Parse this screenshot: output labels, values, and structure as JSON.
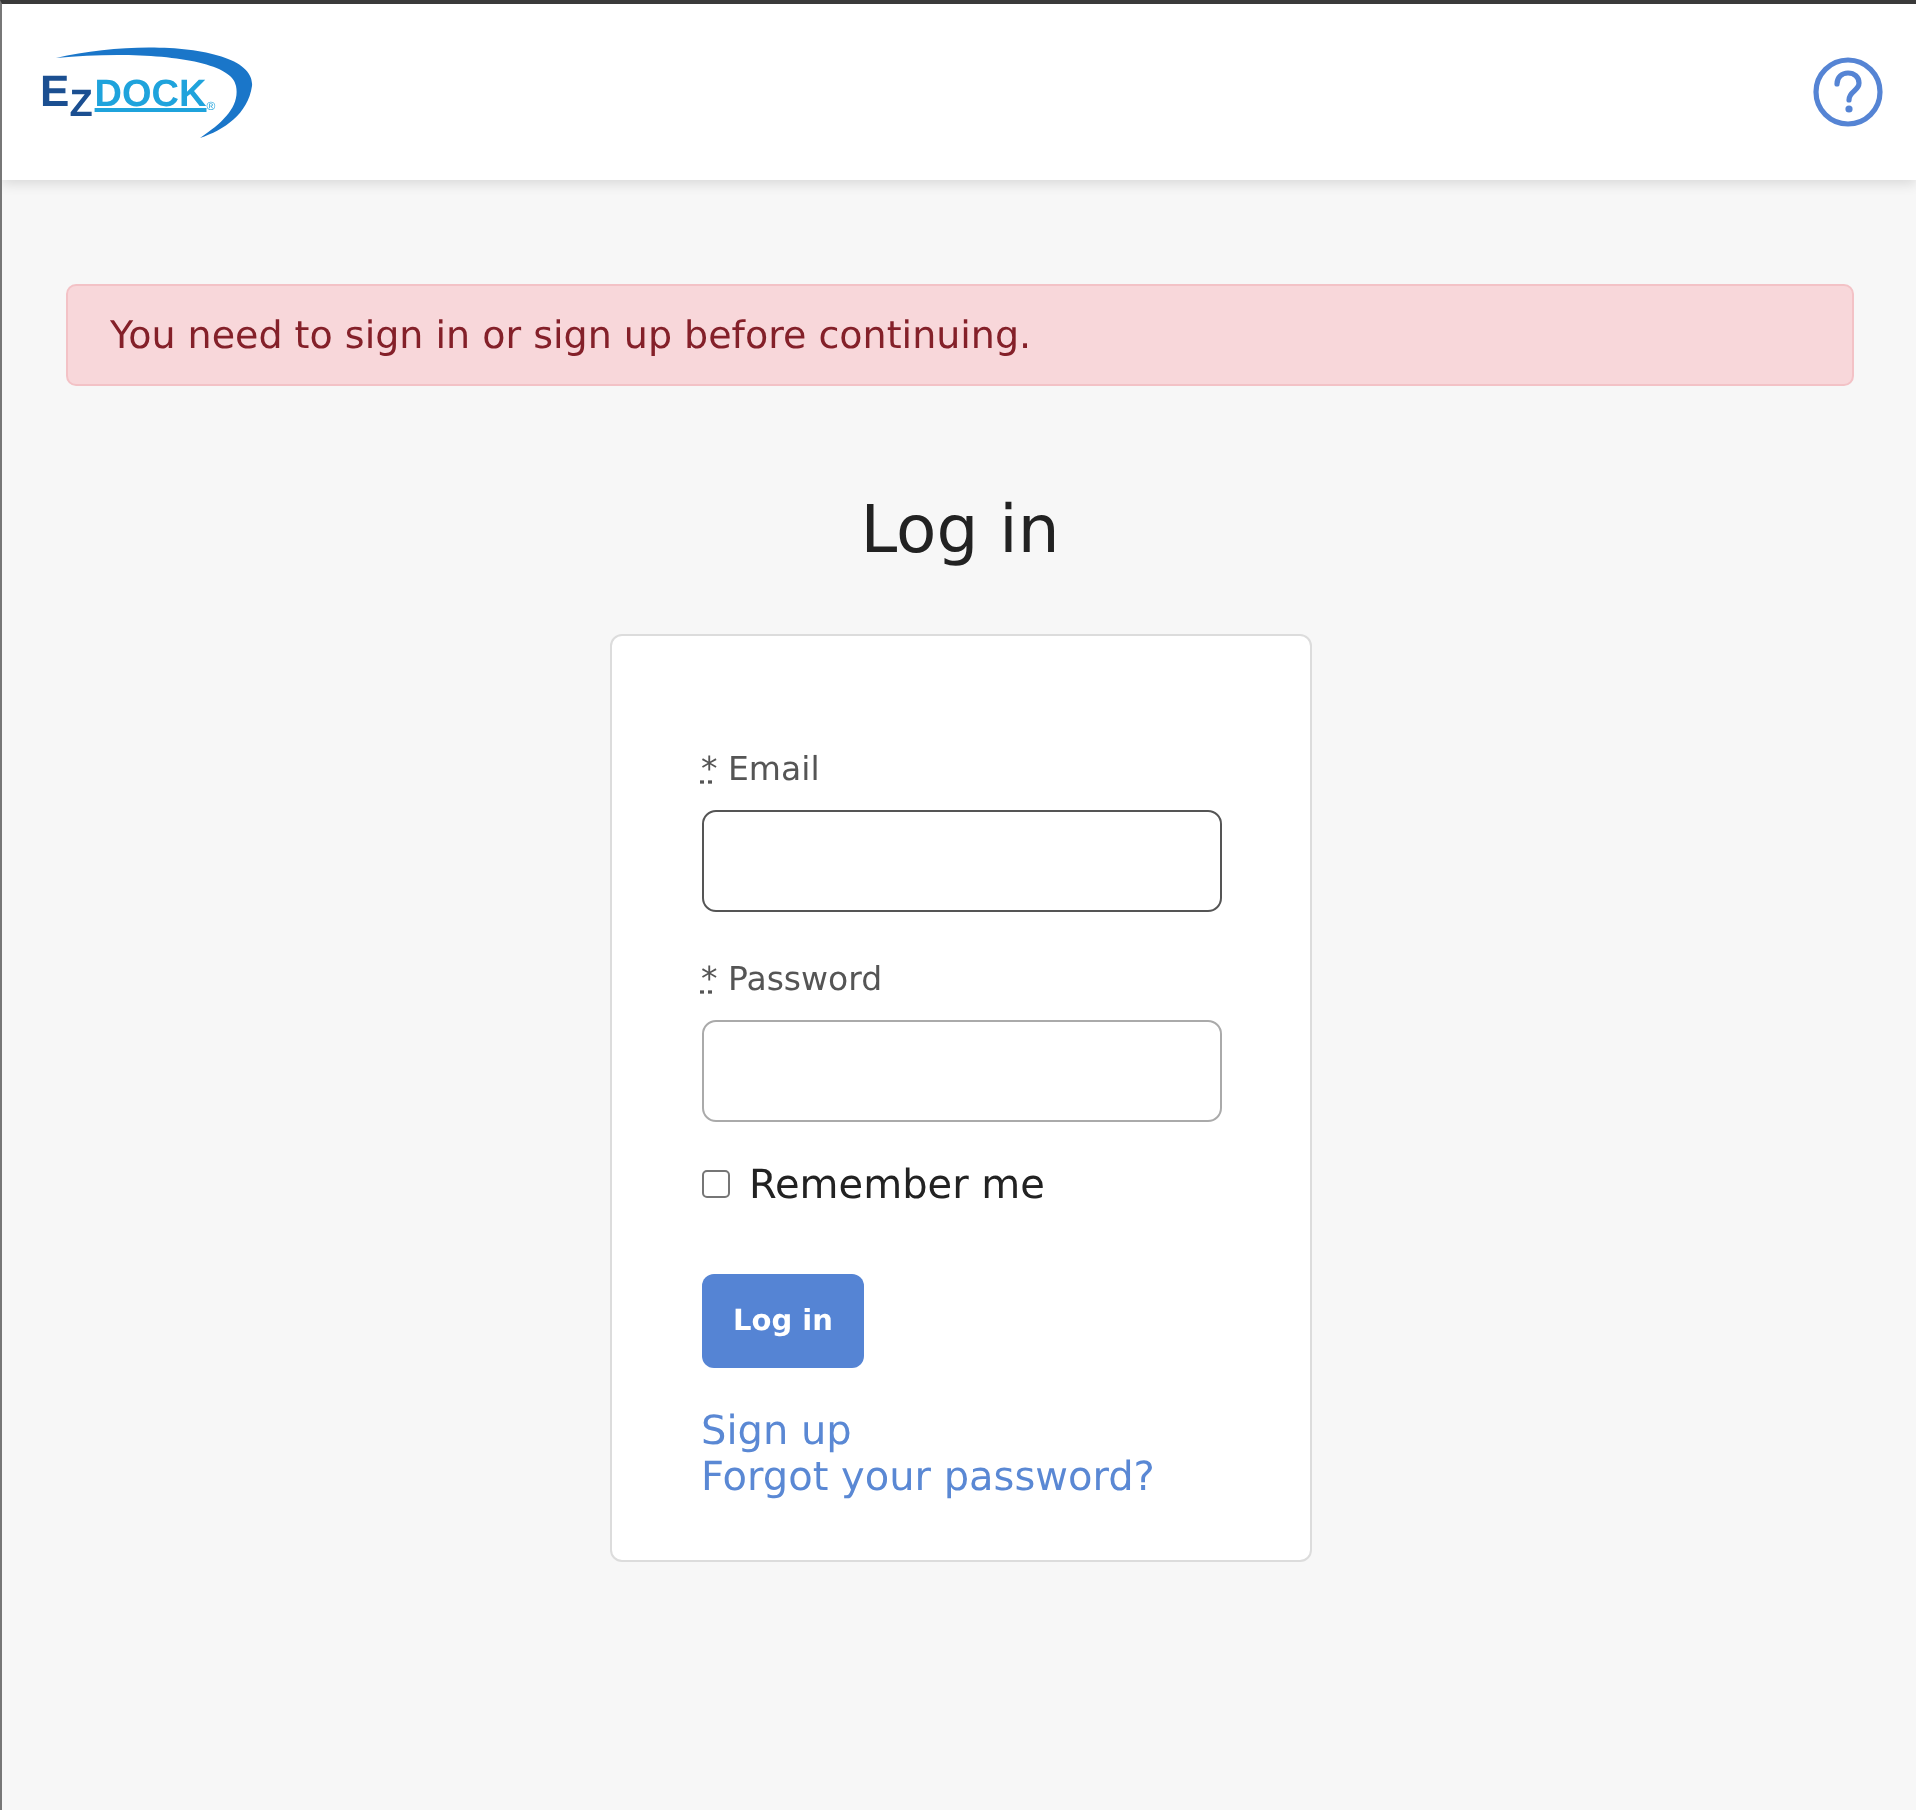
{
  "header": {
    "logo": {
      "initial": "E",
      "sub": "Z",
      "name": "DOCK",
      "mark": "®"
    }
  },
  "alert": {
    "kind": "danger",
    "text": "You need to sign in or sign up before continuing."
  },
  "title": "Log in",
  "form": {
    "fields": [
      {
        "marker": "*",
        "label": "Email",
        "focused": true
      },
      {
        "marker": "*",
        "label": "Password",
        "focused": false
      }
    ],
    "remember": {
      "label": "Remember me",
      "checked": false
    },
    "submit": "Log in",
    "links": [
      "Sign up",
      "Forgot your password?"
    ]
  }
}
